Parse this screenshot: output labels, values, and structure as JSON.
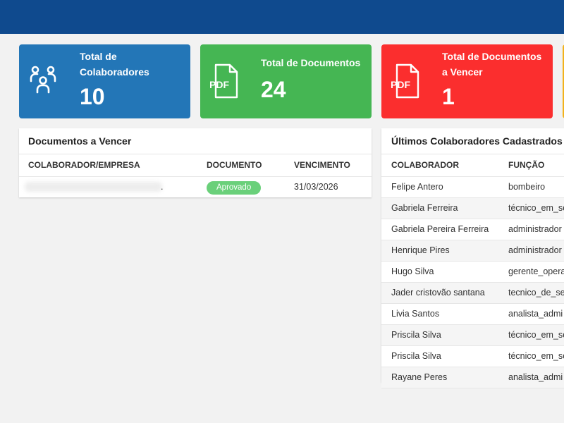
{
  "cards": [
    {
      "title": "Total de Colaboradores",
      "value": "10",
      "icon": "users-icon",
      "color": "#2376b7"
    },
    {
      "title": "Total de Documentos",
      "value": "24",
      "icon": "pdf-icon",
      "color": "#45b653"
    },
    {
      "title": "Total de Documentos a Vencer",
      "value": "1",
      "icon": "pdf-icon",
      "color": "#fb2e2e"
    }
  ],
  "documentos_a_vencer": {
    "title": "Documentos a Vencer",
    "columns": [
      "COLABORADOR/EMPRESA",
      "DOCUMENTO",
      "VENCIMENTO"
    ],
    "rows": [
      {
        "colaborador": ".",
        "documento": "Aprovado",
        "vencimento": "31/03/2026"
      }
    ]
  },
  "ultimos_colaboradores": {
    "title": "Últimos Colaboradores Cadastrados",
    "columns": [
      "COLABORADOR",
      "FUNÇÃO"
    ],
    "rows": [
      {
        "nome": "Felipe Antero",
        "funcao": "bombeiro"
      },
      {
        "nome": "Gabriela Ferreira",
        "funcao": "técnico_em_se"
      },
      {
        "nome": "Gabriela Pereira Ferreira",
        "funcao": "administrador"
      },
      {
        "nome": "Henrique Pires",
        "funcao": "administrador"
      },
      {
        "nome": "Hugo Silva",
        "funcao": "gerente_opera"
      },
      {
        "nome": "Jader cristovão santana",
        "funcao": "tecnico_de_se"
      },
      {
        "nome": "Livia Santos",
        "funcao": "analista_admi"
      },
      {
        "nome": "Priscila Silva",
        "funcao": "técnico_em_se"
      },
      {
        "nome": "Priscila Silva",
        "funcao": "técnico_em_se"
      },
      {
        "nome": "Rayane Peres",
        "funcao": "analista_admi"
      }
    ]
  },
  "colors": {
    "topbar": "#0f4a8e",
    "badge": "#6ad07a"
  }
}
